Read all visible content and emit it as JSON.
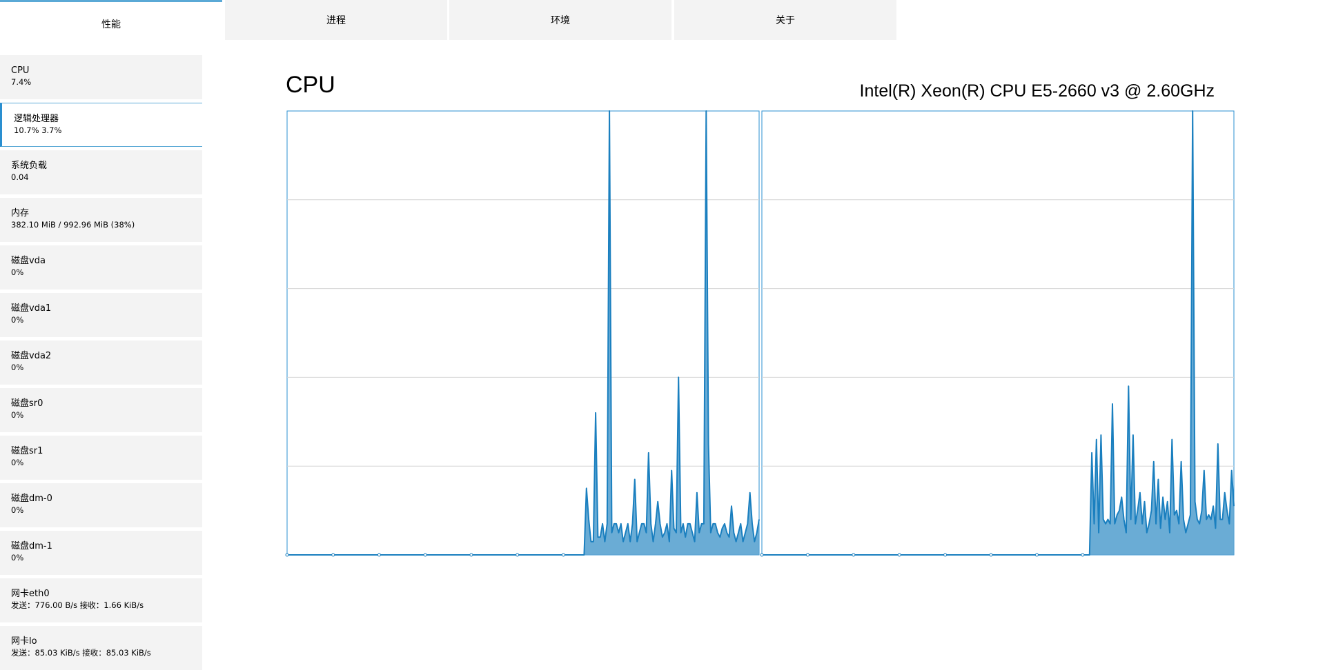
{
  "tabs": [
    {
      "label": "性能",
      "active": true
    },
    {
      "label": "进程",
      "active": false
    },
    {
      "label": "环境",
      "active": false
    },
    {
      "label": "关于",
      "active": false
    }
  ],
  "sidebar": {
    "items": [
      {
        "name": "CPU",
        "value": "7.4%"
      },
      {
        "name": "逻辑处理器",
        "value": "10.7% 3.7%",
        "active": true
      },
      {
        "name": "系统负载",
        "value": "0.04"
      },
      {
        "name": "内存",
        "value": "382.10 MiB / 992.96 MiB (38%)"
      },
      {
        "name": "磁盘vda",
        "value": "0%"
      },
      {
        "name": "磁盘vda1",
        "value": "0%"
      },
      {
        "name": "磁盘vda2",
        "value": "0%"
      },
      {
        "name": "磁盘sr0",
        "value": "0%"
      },
      {
        "name": "磁盘sr1",
        "value": "0%"
      },
      {
        "name": "磁盘dm-0",
        "value": "0%"
      },
      {
        "name": "磁盘dm-1",
        "value": "0%"
      },
      {
        "name": "网卡eth0",
        "value": "发送：776.00 B/s 接收：1.66 KiB/s"
      },
      {
        "name": "网卡lo",
        "value": "发送：85.03 KiB/s 接收：85.03 KiB/s"
      }
    ]
  },
  "main": {
    "title": "CPU",
    "cpu_model": "Intel(R) Xeon(R) CPU E5-2660 v3 @ 2.60GHz"
  },
  "colors": {
    "accent": "#2a8fd0",
    "line": "#1a7fbf",
    "fill": "#5aa3d0",
    "grid": "#d4d4d4",
    "tab_bg": "#f3f3f3"
  },
  "chart_data": [
    {
      "type": "area",
      "ylim": [
        0,
        100
      ],
      "grid": true,
      "values": [
        0,
        0,
        0,
        0,
        0,
        0,
        0,
        0,
        0,
        0,
        0,
        0,
        0,
        0,
        0,
        0,
        0,
        0,
        0,
        0,
        0,
        0,
        0,
        0,
        0,
        0,
        0,
        0,
        0,
        0,
        0,
        0,
        0,
        0,
        0,
        0,
        0,
        0,
        0,
        0,
        0,
        0,
        0,
        0,
        0,
        0,
        0,
        0,
        0,
        0,
        0,
        0,
        0,
        0,
        0,
        0,
        0,
        0,
        0,
        0,
        0,
        0,
        0,
        0,
        0,
        0,
        0,
        0,
        0,
        0,
        0,
        0,
        0,
        0,
        0,
        0,
        0,
        0,
        0,
        0,
        0,
        0,
        0,
        0,
        0,
        0,
        0,
        0,
        0,
        0,
        0,
        0,
        0,
        0,
        0,
        0,
        0,
        0,
        0,
        0,
        0,
        0,
        0,
        0,
        0,
        0,
        0,
        0,
        0,
        0,
        0,
        0,
        0,
        0,
        0,
        0,
        0,
        0,
        0,
        0,
        0,
        0,
        0,
        0,
        0,
        0,
        0,
        0,
        0,
        0,
        15,
        8,
        3,
        3,
        32,
        4,
        4,
        7,
        3,
        7,
        100,
        5,
        7,
        7,
        5,
        7,
        3,
        5,
        7,
        3,
        7,
        17,
        3,
        5,
        7,
        7,
        5,
        23,
        7,
        3,
        7,
        12,
        7,
        4,
        5,
        7,
        3,
        19,
        6,
        5,
        40,
        5,
        7,
        4,
        7,
        7,
        5,
        3,
        14,
        5,
        7,
        7,
        100,
        25,
        5,
        7,
        7,
        5,
        4,
        6,
        7,
        5,
        4,
        11,
        5,
        3,
        5,
        7,
        3,
        5,
        7,
        14,
        7,
        3,
        5,
        8
      ]
    },
    {
      "type": "area",
      "ylim": [
        0,
        100
      ],
      "grid": true,
      "values": [
        0,
        0,
        0,
        0,
        0,
        0,
        0,
        0,
        0,
        0,
        0,
        0,
        0,
        0,
        0,
        0,
        0,
        0,
        0,
        0,
        0,
        0,
        0,
        0,
        0,
        0,
        0,
        0,
        0,
        0,
        0,
        0,
        0,
        0,
        0,
        0,
        0,
        0,
        0,
        0,
        0,
        0,
        0,
        0,
        0,
        0,
        0,
        0,
        0,
        0,
        0,
        0,
        0,
        0,
        0,
        0,
        0,
        0,
        0,
        0,
        0,
        0,
        0,
        0,
        0,
        0,
        0,
        0,
        0,
        0,
        0,
        0,
        0,
        0,
        0,
        0,
        0,
        0,
        0,
        0,
        0,
        0,
        0,
        0,
        0,
        0,
        0,
        0,
        0,
        0,
        0,
        0,
        0,
        0,
        0,
        0,
        0,
        0,
        0,
        0,
        0,
        0,
        0,
        0,
        0,
        0,
        0,
        0,
        0,
        0,
        0,
        0,
        0,
        0,
        0,
        0,
        0,
        0,
        0,
        0,
        0,
        0,
        0,
        0,
        0,
        0,
        0,
        0,
        0,
        0,
        0,
        0,
        0,
        0,
        0,
        0,
        0,
        0,
        0,
        0,
        0,
        0,
        0,
        0,
        23,
        7,
        26,
        5,
        27,
        8,
        7,
        8,
        7,
        34,
        7,
        9,
        10,
        13,
        8,
        5,
        38,
        8,
        27,
        7,
        10,
        14,
        7,
        12,
        5,
        7,
        10,
        21,
        7,
        17,
        6,
        13,
        8,
        12,
        5,
        26,
        9,
        10,
        7,
        21,
        8,
        5,
        7,
        9,
        100,
        12,
        8,
        7,
        10,
        19,
        8,
        9,
        8,
        11,
        6,
        25,
        8,
        8,
        14,
        10,
        7,
        19,
        11
      ]
    }
  ]
}
